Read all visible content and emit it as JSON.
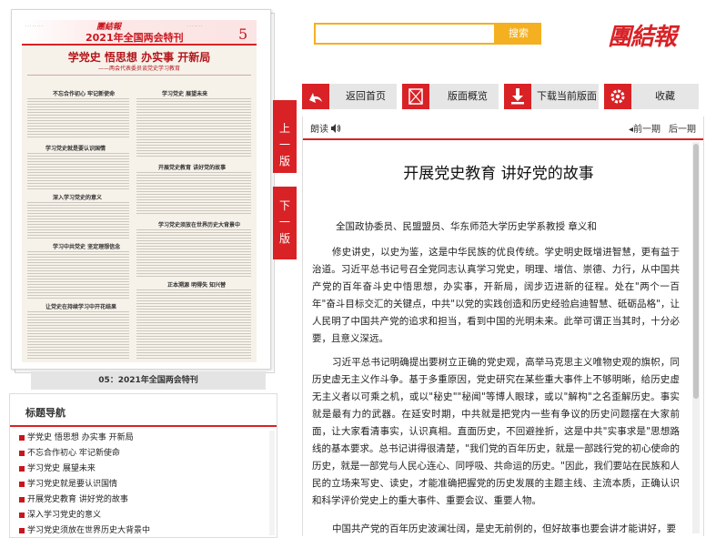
{
  "newspaper_page": {
    "masthead": "團結報",
    "issue_title": "2021年全国两会特刊",
    "page_number": "5",
    "headline": "学党史 悟思想 办实事 开新局",
    "subhead": "——两会代表委员谈党史学习教育",
    "column_titles": [
      "不忘合作初心 牢记新使命",
      "学习党史 展望未来",
      "学习党史就是要认识国情",
      "开展党史教育 讲好党的故事",
      "深入学习党史的意义",
      "学习党史须放在世界历史大背景中",
      "学习中共党史 坚定理想信念",
      "让党史在持续学习中开花结果",
      "正本溯源 明得失 知兴替"
    ],
    "caption": "05：2021年全国两会特刊"
  },
  "page_turn": {
    "prev_label": "上一版",
    "next_label": "下一版"
  },
  "search": {
    "value": "",
    "placeholder": "",
    "button_label": "搜索"
  },
  "logo_text": "團結報",
  "toolbar": {
    "home_label": "返回首页",
    "overview_label": "版面概览",
    "download_label": "下载当前版面",
    "favorite_label": "收藏"
  },
  "article": {
    "read_aloud": "朗读",
    "prev_issue": "前一期",
    "next_issue": "后一期",
    "title": "开展党史教育 讲好党的故事",
    "author": "全国政协委员、民盟盟员、华东师范大学历史学系教授 章义和",
    "paragraphs": [
      "修史讲史，以史为鉴，这是中华民族的优良传统。学史明史既增进智慧，更有益于治道。习近平总书记号召全党同志认真学习党史，明理、增信、崇德、力行，从中国共产党的百年奋斗史中悟思想，办实事，开新局，阔步迈进新的征程。处在\"两个一百年\"奋斗目标交汇的关键点，中共\"以党的实践创造和历史经验启迪智慧、砥砺品格\"，让人民明了中国共产党的追求和担当，看到中国的光明未来。此举可谓正当其时，十分必要，且意义深远。",
      "习近平总书记明确提出要树立正确的党史观，高举马克思主义唯物史观的旗帜，同历史虚无主义作斗争。基于多重原因，党史研究在某些重大事件上不够明晰，给历史虚无主义者以可乘之机，或以\"秘史\"\"秘闻\"等博人眼球，或以\"解构\"之名歪解历史。事实就是最有力的武器。在延安时期，中共就是把党内一些有争议的历史问题摆在大家前面，让大家看清事实，认识真相。直面历史，不回避挫折，这是中共\"实事求是\"思想路线的基本要求。总书记讲得很清楚，\"我们党的百年历史，就是一部践行党的初心使命的历史，就是一部党与人民心连心、同呼吸、共命运的历史。\"因此，我们要站在民族和人民的立场来写史、读史，才能准确把握党的历史发展的主题主线、主流本质，正确认识和科学评价党史上的重大事件、重要会议、重要人物。",
      "中国共产党的百年历史波澜壮阔，是史无前例的，但好故事也要会讲才能讲好，要"
    ]
  },
  "headline_nav": {
    "title": "标题导航",
    "items": [
      "学党史 悟思想 办实事 开新局",
      "不忘合作初心 牢记新使命",
      "学习党史 展望未来",
      "学习党史就是要认识国情",
      "开展党史教育 讲好党的故事",
      "深入学习党史的意义",
      "学习党史须放在世界历史大背景中"
    ]
  },
  "colors": {
    "accent_red": "#d92226",
    "search_yellow": "#f4b020"
  },
  "icons": [
    "home-arrow-icon",
    "layout-grid-icon",
    "download-icon",
    "gear-icon",
    "speaker-icon"
  ]
}
